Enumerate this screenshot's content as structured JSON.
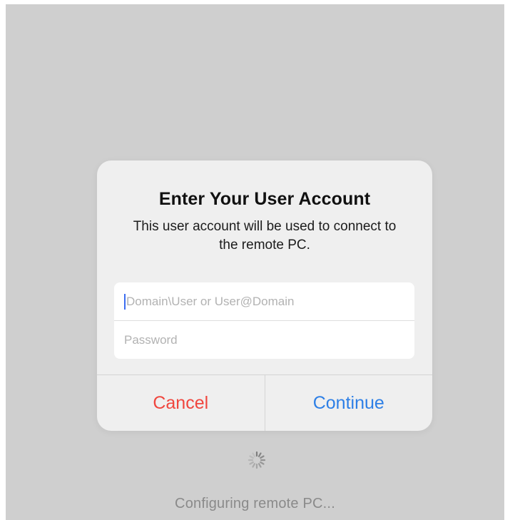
{
  "dialog": {
    "title": "Enter Your User Account",
    "message": "This user account will be used to connect to the remote PC.",
    "username": {
      "value": "",
      "placeholder": "Domain\\User or User@Domain"
    },
    "password": {
      "value": "",
      "placeholder": "Password"
    },
    "buttons": {
      "cancel": "Cancel",
      "continue": "Continue"
    }
  },
  "status": {
    "icon": "activity-spinner-icon",
    "text": "Configuring remote PC..."
  },
  "colors": {
    "background": "#cfcfcf",
    "dialog": "#efefef",
    "cancel": "#f0463e",
    "continue": "#2d7fe6",
    "caret": "#3b6cf0"
  }
}
